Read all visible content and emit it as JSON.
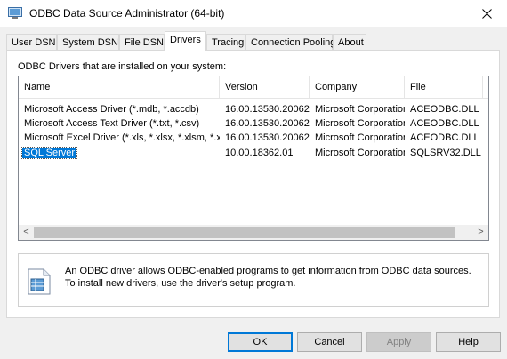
{
  "window": {
    "title": "ODBC Data Source Administrator (64-bit)",
    "close_glyph": "✕"
  },
  "tabs": [
    {
      "label": "User DSN"
    },
    {
      "label": "System DSN"
    },
    {
      "label": "File DSN"
    },
    {
      "label": "Drivers",
      "active": true
    },
    {
      "label": "Tracing"
    },
    {
      "label": "Connection Pooling"
    },
    {
      "label": "About"
    }
  ],
  "drivers_panel": {
    "label": "ODBC Drivers that are installed on your system:",
    "columns": [
      "Name",
      "Version",
      "Company",
      "File"
    ],
    "rows": [
      {
        "name": "Microsoft Access Driver (*.mdb, *.accdb)",
        "version": "16.00.13530.20062",
        "company": "Microsoft Corporation",
        "file": "ACEODBC.DLL"
      },
      {
        "name": "Microsoft Access Text Driver (*.txt, *.csv)",
        "version": "16.00.13530.20062",
        "company": "Microsoft Corporation",
        "file": "ACEODBC.DLL"
      },
      {
        "name": "Microsoft Excel Driver (*.xls, *.xlsx, *.xlsm, *.xlsb)",
        "version": "16.00.13530.20062",
        "company": "Microsoft Corporation",
        "file": "ACEODBC.DLL"
      },
      {
        "name": "SQL Server",
        "version": "10.00.18362.01",
        "company": "Microsoft Corporation",
        "file": "SQLSRV32.DLL",
        "selected": true
      }
    ],
    "scroll_left": "<",
    "scroll_right": ">"
  },
  "info": {
    "text": "An ODBC driver allows ODBC-enabled programs to get information from ODBC data sources.  To install new drivers, use the driver's setup program."
  },
  "buttons": {
    "ok": "OK",
    "cancel": "Cancel",
    "apply": "Apply",
    "help": "Help"
  },
  "colors": {
    "selection": "#0078d7",
    "default_button_border": "#0078d7"
  }
}
